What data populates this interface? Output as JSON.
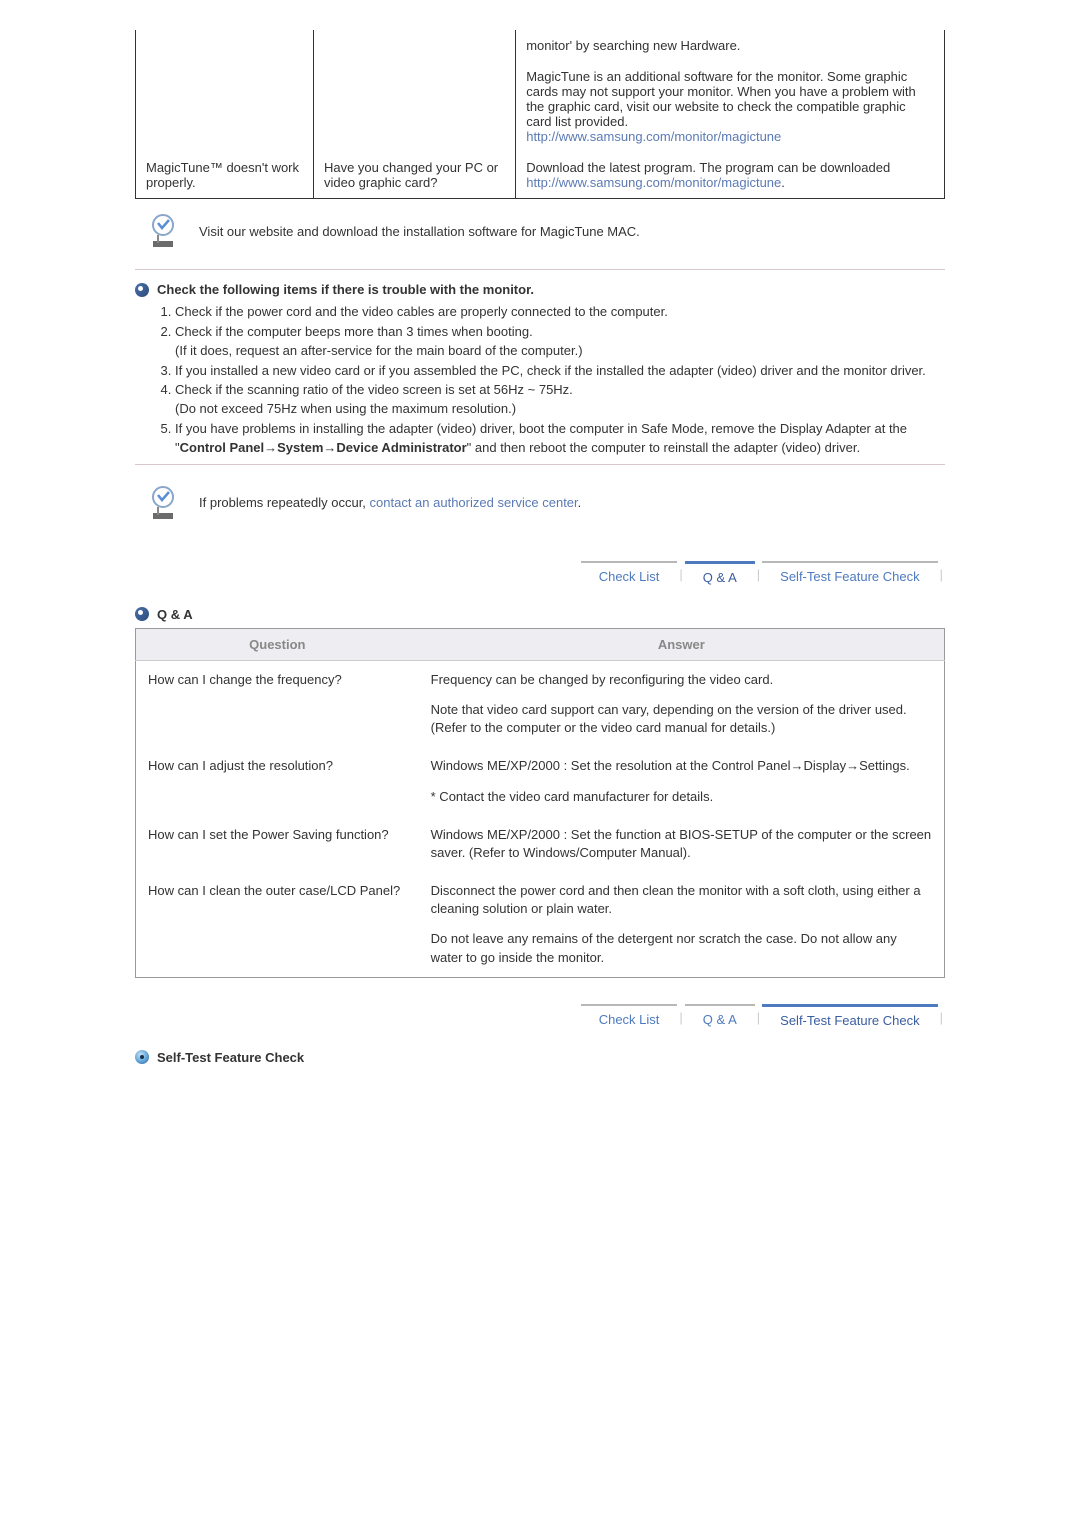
{
  "trouble_table": {
    "r1": {
      "c1": "",
      "c2": "",
      "c3": "monitor' by searching new Hardware."
    },
    "r2": {
      "c1": "",
      "c2": "",
      "c3_text": "MagicTune is an additional software for the monitor. Some graphic cards may not support your monitor. When you have a problem with the graphic card, visit our website to check the compatible graphic card list provided.",
      "c3_link": "http://www.samsung.com/monitor/magictune"
    },
    "r3": {
      "c1": "MagicTune™ doesn't work properly.",
      "c2": "Have you changed your PC or video graphic card?",
      "c3_text": "Download the latest program. The program can be downloaded ",
      "c3_link": "http://www.samsung.com/monitor/magictune",
      "c3_suffix": "."
    }
  },
  "note1": "Visit our website and download the installation software for MagicTune MAC.",
  "checklist_head": "Check the following items if there is trouble with the monitor.",
  "checklist": {
    "i1": "Check if the power cord and the video cables are properly connected to the computer.",
    "i2a": "Check if the computer beeps more than 3 times when booting.",
    "i2b": "(If it does, request an after-service for the main board of the computer.)",
    "i3": "If you installed a new video card or if you assembled the PC, check if the installed the adapter (video) driver and the monitor driver.",
    "i4a": "Check if the scanning ratio of the video screen is set at 56Hz ~ 75Hz.",
    "i4b": "(Do not exceed 75Hz when using the maximum resolution.)",
    "i5a": "If you have problems in installing the adapter (video) driver, boot the computer in Safe Mode, remove the Display Adapter at the \"",
    "i5b": "Control Panel→System→Device Administrator",
    "i5c": "\" and then reboot the computer to reinstall the adapter (video) driver."
  },
  "note2_a": "If problems repeatedly occur, ",
  "note2_link": "contact an authorized service center",
  "note2_b": ".",
  "tabs": {
    "checklist": "Check List",
    "qa": "Q & A",
    "selftest": "Self-Test Feature Check"
  },
  "qa_head": "Q & A",
  "qa_table": {
    "th_q": "Question",
    "th_a": "Answer",
    "r1_q": "How can I change the frequency?",
    "r1_a1": "Frequency can be changed by reconfiguring the video card.",
    "r1_a2": "Note that video card support can vary, depending on the version of the driver used. (Refer to the computer or the video card manual for details.)",
    "r2_q": "How can I adjust the resolution?",
    "r2_a1": "Windows ME/XP/2000 : Set the resolution at the Control Panel→Display→Settings.",
    "r2_a2": "* Contact the video card manufacturer for details.",
    "r3_q": "How can I set the Power Saving function?",
    "r3_a1": "Windows ME/XP/2000 : Set the function at BIOS-SETUP of the computer or the screen saver. (Refer to Windows/Computer Manual).",
    "r4_q": "How can I clean the outer case/LCD Panel?",
    "r4_a1": "Disconnect the power cord and then clean the monitor with a soft cloth, using either a cleaning solution or plain water.",
    "r4_a2": "Do not leave any remains of the detergent nor scratch the case. Do not allow any water to go inside the monitor."
  },
  "selftest_head": "Self-Test Feature Check"
}
